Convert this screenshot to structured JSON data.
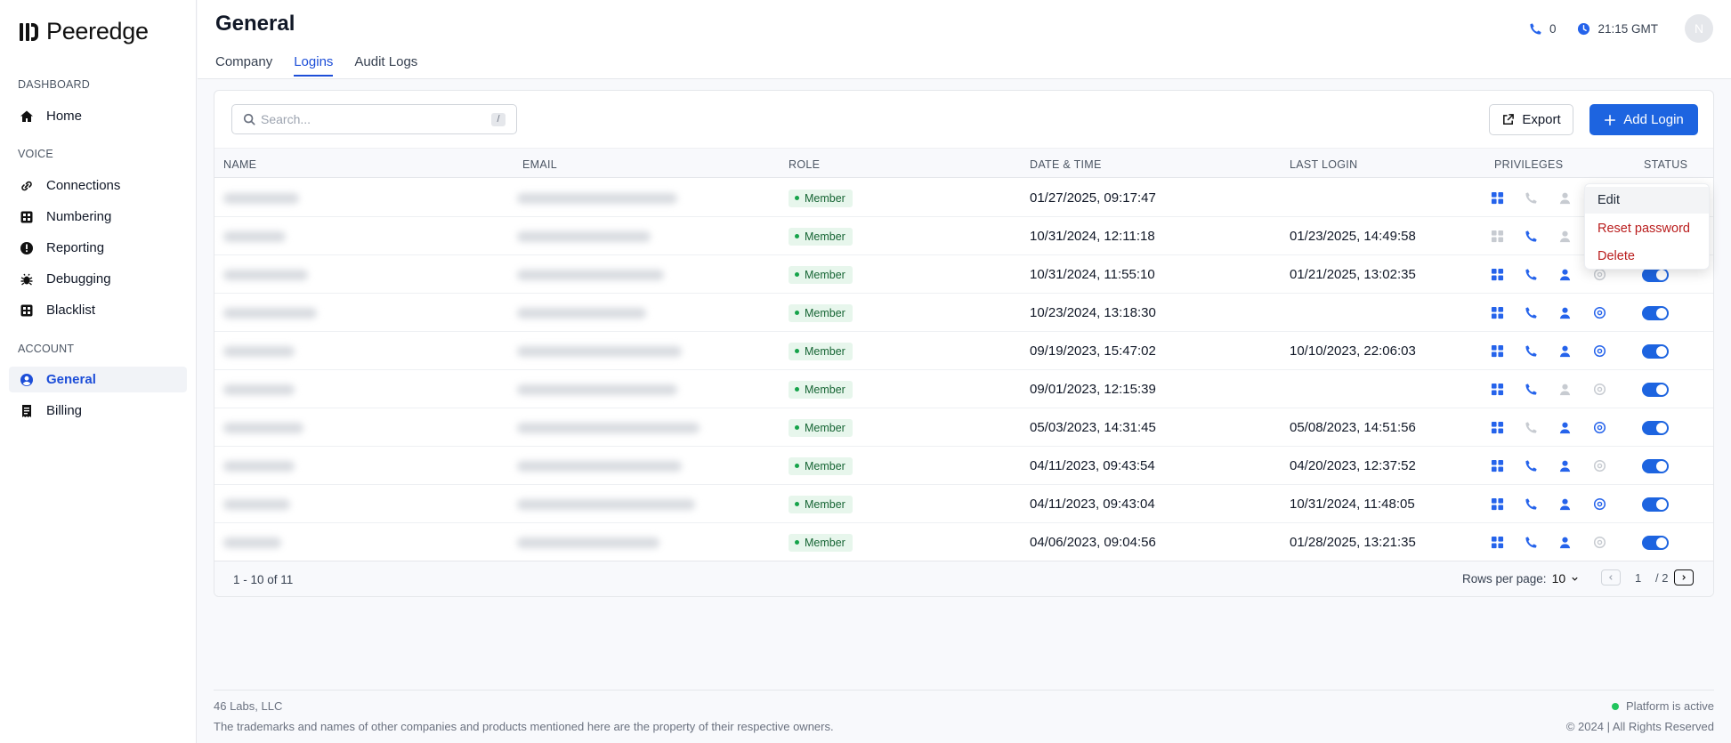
{
  "brand": {
    "name": "Peeredge"
  },
  "sidebar": {
    "sections": [
      {
        "label": "DASHBOARD"
      },
      {
        "label": "VOICE"
      },
      {
        "label": "ACCOUNT"
      }
    ],
    "items": [
      {
        "label": "Home",
        "icon": "home-icon"
      },
      {
        "label": "Connections",
        "icon": "link-icon"
      },
      {
        "label": "Numbering",
        "icon": "grid-icon"
      },
      {
        "label": "Reporting",
        "icon": "alert-circle-icon"
      },
      {
        "label": "Debugging",
        "icon": "bug-icon"
      },
      {
        "label": "Blacklist",
        "icon": "grid-icon"
      },
      {
        "label": "General",
        "icon": "user-circle-icon",
        "active": true
      },
      {
        "label": "Billing",
        "icon": "receipt-icon"
      }
    ]
  },
  "header": {
    "title": "General",
    "tabs": [
      {
        "label": "Company"
      },
      {
        "label": "Logins",
        "active": true
      },
      {
        "label": "Audit Logs"
      }
    ],
    "calls_count": "0",
    "time": "21:15 GMT",
    "avatar_initial": "N"
  },
  "toolbar": {
    "search_placeholder": "Search...",
    "search_shortcut": "/",
    "export_label": "Export",
    "add_label": "Add Login"
  },
  "table": {
    "columns": [
      "NAME",
      "EMAIL",
      "ROLE",
      "DATE & TIME",
      "LAST LOGIN",
      "PRIVILEGES",
      "STATUS"
    ],
    "rows": [
      {
        "role": "Member",
        "date": "01/27/2025, 09:17:47",
        "last_login": "",
        "privs": [
          1,
          0,
          0,
          0
        ]
      },
      {
        "role": "Member",
        "date": "10/31/2024, 12:11:18",
        "last_login": "01/23/2025, 14:49:58",
        "privs": [
          0,
          1,
          0,
          0
        ]
      },
      {
        "role": "Member",
        "date": "10/31/2024, 11:55:10",
        "last_login": "01/21/2025, 13:02:35",
        "privs": [
          1,
          1,
          1,
          0
        ]
      },
      {
        "role": "Member",
        "date": "10/23/2024, 13:18:30",
        "last_login": "",
        "privs": [
          1,
          1,
          1,
          1
        ]
      },
      {
        "role": "Member",
        "date": "09/19/2023, 15:47:02",
        "last_login": "10/10/2023, 22:06:03",
        "privs": [
          1,
          1,
          1,
          1
        ]
      },
      {
        "role": "Member",
        "date": "09/01/2023, 12:15:39",
        "last_login": "",
        "privs": [
          1,
          1,
          0,
          0
        ]
      },
      {
        "role": "Member",
        "date": "05/03/2023, 14:31:45",
        "last_login": "05/08/2023, 14:51:56",
        "privs": [
          1,
          0,
          1,
          1
        ]
      },
      {
        "role": "Member",
        "date": "04/11/2023, 09:43:54",
        "last_login": "04/20/2023, 12:37:52",
        "privs": [
          1,
          1,
          1,
          0
        ]
      },
      {
        "role": "Member",
        "date": "04/11/2023, 09:43:04",
        "last_login": "10/31/2024, 11:48:05",
        "privs": [
          1,
          1,
          1,
          1
        ]
      },
      {
        "role": "Member",
        "date": "04/06/2023, 09:04:56",
        "last_login": "01/28/2025, 13:21:35",
        "privs": [
          1,
          1,
          1,
          0
        ]
      }
    ]
  },
  "pagination": {
    "range": "1 - 10 of 11",
    "rows_per_page_label": "Rows per page:",
    "rows_per_page": "10",
    "page": "1",
    "total": "/ 2"
  },
  "menu": {
    "edit": "Edit",
    "reset": "Reset password",
    "delete": "Delete"
  },
  "footer": {
    "company": "46 Labs, LLC",
    "disclaimer": "The trademarks and names of other companies and products mentioned here are the property of their respective owners.",
    "status": "Platform is active",
    "copyright": "© 2024 | All Rights Reserved"
  },
  "colors": {
    "accent": "#1d64e0",
    "active_priv": "#2563eb",
    "inactive_priv": "#c7cbd1",
    "danger": "#b91c1c",
    "success": "#16a34a"
  }
}
